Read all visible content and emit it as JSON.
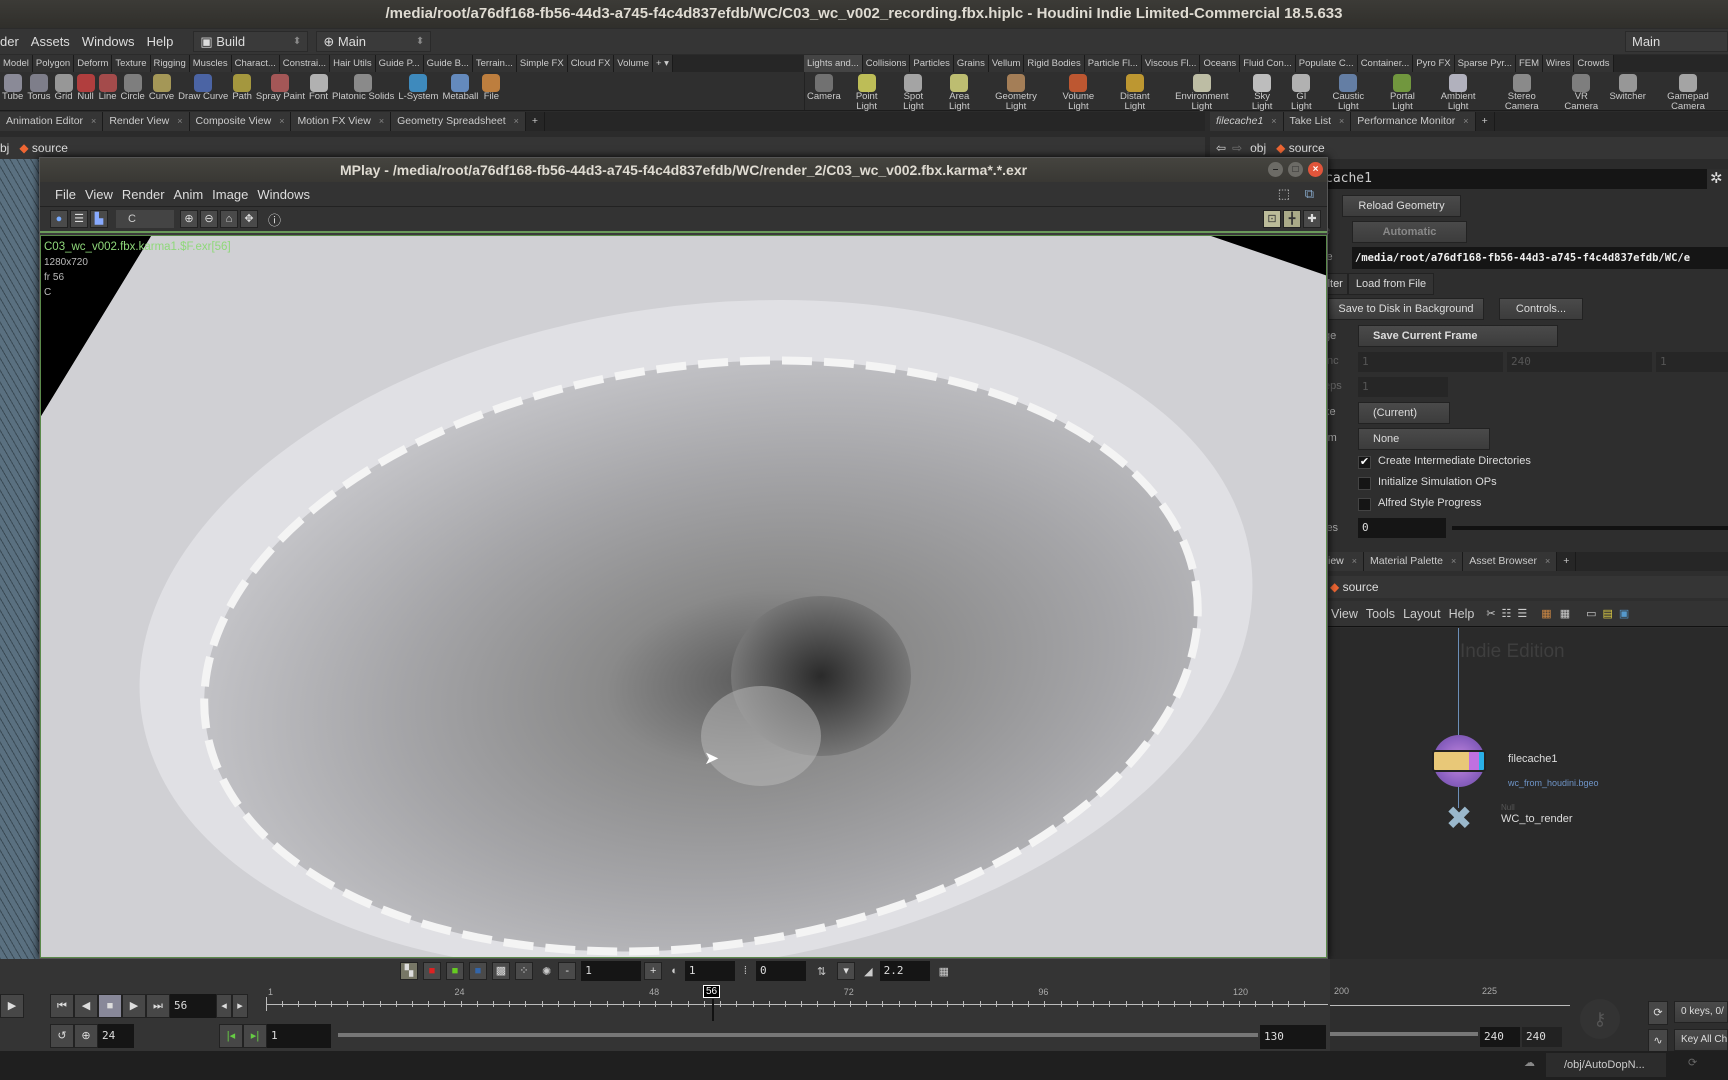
{
  "window_title": "/media/root/a76df168-fb56-44d3-a745-f4c4d837efdb/WC/C03_wc_v002_recording.fbx.hiplc - Houdini Indie Limited-Commercial 18.5.633",
  "main_menu": [
    "der",
    "Assets",
    "Windows",
    "Help"
  ],
  "desktops": {
    "build": "Build",
    "main": "Main",
    "right_main": "Main"
  },
  "shelf_tabs_left": [
    "Model",
    "Polygon",
    "Deform",
    "Texture",
    "Rigging",
    "Muscles",
    "Charact...",
    "Constrai...",
    "Hair Utils",
    "Guide P...",
    "Guide B...",
    "Terrain...",
    "Simple FX",
    "Cloud FX",
    "Volume"
  ],
  "shelf_tabs_right": [
    "Lights and...",
    "Collisions",
    "Particles",
    "Grains",
    "Vellum",
    "Rigid Bodies",
    "Particle Fl...",
    "Viscous Fl...",
    "Oceans",
    "Fluid Con...",
    "Populate C...",
    "Container...",
    "Pyro FX",
    "Sparse Pyr...",
    "FEM",
    "Wires",
    "Crowds"
  ],
  "shelf_tools_left": [
    "Tube",
    "Torus",
    "Grid",
    "Null",
    "Line",
    "Circle",
    "Curve",
    "Draw Curve",
    "Path",
    "Spray Paint",
    "Font",
    "Platonic Solids",
    "L-System",
    "Metaball",
    "File"
  ],
  "shelf_tools_right": [
    "Camera",
    "Point Light",
    "Spot Light",
    "Area Light",
    "Geometry Light",
    "Volume Light",
    "Distant Light",
    "Environment Light",
    "Sky Light",
    "GI Light",
    "Caustic Light",
    "Portal Light",
    "Ambient Light",
    "Stereo Camera",
    "VR Camera",
    "Switcher",
    "Gamepad Camera"
  ],
  "pane_tabs_left": [
    "Animation Editor",
    "Render View",
    "Composite View",
    "Motion FX View",
    "Geometry Spreadsheet"
  ],
  "pane_tabs_right": [
    "filecache1",
    "Take List",
    "Performance Monitor"
  ],
  "path_left": {
    "obj": "bj",
    "node": "source"
  },
  "path_right": {
    "obj": "obj",
    "node": "source"
  },
  "mplay": {
    "title": "MPlay - /media/root/a76df168-fb56-44d3-a745-f4c4d837efdb/WC/render_2/C03_wc_v002.fbx.karma*.*.exr",
    "menu": [
      "File",
      "View",
      "Render",
      "Anim",
      "Image",
      "Windows"
    ],
    "channel": "C",
    "overlay": {
      "file": "C03_wc_v002.fbx.karma1.$F.exr[56]",
      "resolution": "1280x720",
      "frame": "fr 56",
      "channel": "C"
    },
    "frame_field": "56",
    "fps": "24",
    "range_start": "1",
    "range_end": "130",
    "current_frame": "56",
    "ticks": [
      "1",
      "24",
      "48",
      "72",
      "96",
      "120"
    ],
    "display": {
      "step": "1",
      "exposure": "1",
      "offset": "0",
      "gamma": "2.2"
    }
  },
  "params": {
    "node_name": "cache1",
    "reload_geometry": "Reload Geometry",
    "mode_label": "e",
    "mode_value": "Automatic",
    "file_label": "le",
    "file_value": "/media/root/a76df168-fb56-44d3-a745-f4c4d837efdb/WC/e",
    "tab_filter": "ilter",
    "tab_load": "Load from File",
    "save_bg": "Save to Disk in Background",
    "controls": "Controls...",
    "range_label": "ge",
    "range_value": "Save Current Frame",
    "inc_label": "Inc",
    "inc_values": [
      "1",
      "240",
      "1"
    ],
    "steps_label": "eps",
    "steps_value": "1",
    "take_label": "ke",
    "take_value": "(Current)",
    "xform_label": "rm",
    "xform_value": "None",
    "checks": [
      {
        "label": "Create Intermediate Directories",
        "checked": true
      },
      {
        "label": "Initialize Simulation OPs",
        "checked": false
      },
      {
        "label": "Alfred Style Progress",
        "checked": false
      }
    ],
    "retries_label": "ies",
    "retries_value": "0"
  },
  "network": {
    "tabs": [
      "iew",
      "Material Palette",
      "Asset Browser"
    ],
    "path": "source",
    "menu": [
      "View",
      "Tools",
      "Layout",
      "Help"
    ],
    "watermark": "Indie Edition",
    "nodes": [
      {
        "name": "filecache1",
        "sub": "wc_from_houdini.bgeo"
      },
      {
        "type": "Null",
        "name": "WC_to_render"
      }
    ]
  },
  "global_timeline": {
    "ticks": [
      "200",
      "225"
    ],
    "end1": "240",
    "end2": "240",
    "keys": "0 keys, 0/",
    "key_all": "Key All Ch"
  },
  "status": {
    "path": "/obj/AutoDopN..."
  }
}
